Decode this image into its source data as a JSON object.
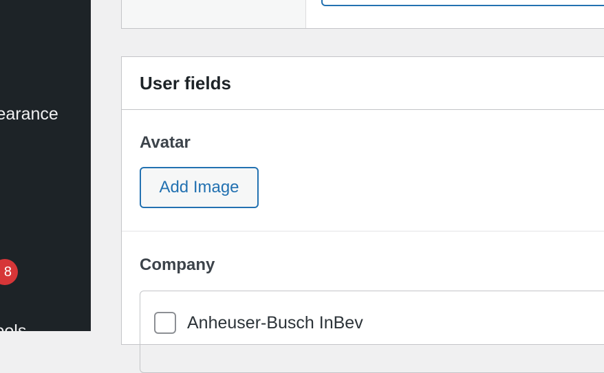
{
  "sidebar": {
    "items": [
      {
        "label": "Appearance"
      },
      {
        "label": "Tools"
      }
    ],
    "plugins_badge": "8"
  },
  "panel": {
    "title": "User fields",
    "avatar": {
      "label": "Avatar",
      "button_label": "Add Image"
    },
    "company": {
      "label": "Company",
      "options": [
        {
          "name": "Anheuser-Busch InBev",
          "checked": false
        }
      ]
    }
  },
  "colors": {
    "sidebar_bg": "#1d2327",
    "accent": "#2271b1",
    "badge": "#d63638",
    "page_bg": "#f0f0f1"
  }
}
